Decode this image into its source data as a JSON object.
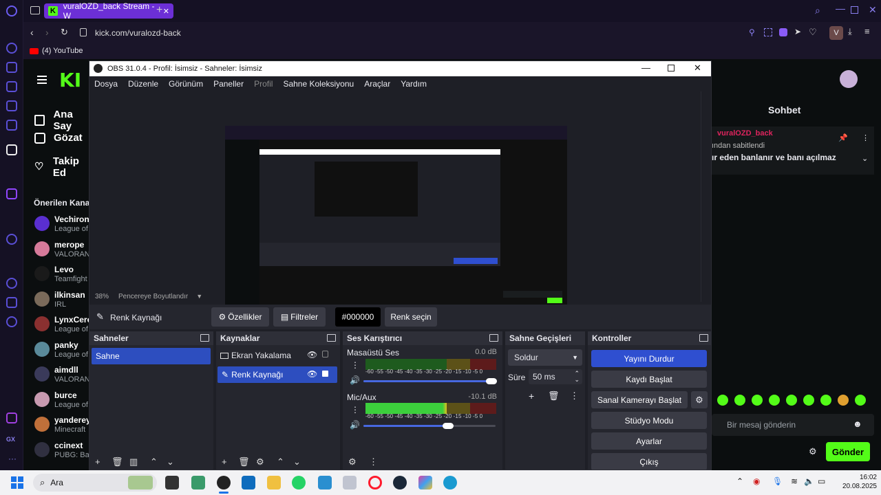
{
  "browser": {
    "tab_title": "vuralOZD_back Stream - W",
    "url": "kick.com/vuralozd-back",
    "bookmark": "(4) YouTube",
    "profile_initial": "V"
  },
  "kick": {
    "nav": [
      "Ana Say",
      "Gözat",
      "Takip Ed"
    ],
    "recommended_title": "Önerilen Kana",
    "channels": [
      {
        "name": "Vechiron",
        "game": "League of",
        "color": "#5a2fd0"
      },
      {
        "name": "merope",
        "game": "VALORAN",
        "color": "#d67a9a"
      },
      {
        "name": "Levo",
        "game": "Teamfight",
        "color": "#1a1a1a"
      },
      {
        "name": "ilkinsan",
        "game": "IRL",
        "color": "#7a6a5a"
      },
      {
        "name": "LynxCere",
        "game": "League of",
        "color": "#8a3030"
      },
      {
        "name": "panky",
        "game": "League of",
        "color": "#5a8a9a"
      },
      {
        "name": "aimdll",
        "game": "VALORAN",
        "color": "#3a3a5a"
      },
      {
        "name": "burce",
        "game": "League of",
        "color": "#c89ab0"
      },
      {
        "name": "yanderey",
        "game": "Minecraft",
        "color": "#c0703a"
      },
      {
        "name": "ccinext",
        "game": "PUBG: Bat",
        "color": "#303040"
      }
    ],
    "chat": {
      "title": "Sohbet",
      "pinned_user": "vuralOZD_back",
      "pinned_label": "ından sabitlendi",
      "pinned_message": "ır eden banlanır ve banı açılmaz",
      "input_placeholder": "Bir mesaj gönderin",
      "send_label": "Gönder"
    }
  },
  "obs": {
    "title": "OBS 31.0.4 - Profil: İsimsiz - Sahneler: İsimsiz",
    "menu": [
      "Dosya",
      "Düzenle",
      "Görünüm",
      "Paneller",
      "Profil",
      "Sahne Koleksiyonu",
      "Araçlar",
      "Yardım"
    ],
    "zoom": "38%",
    "zoom_mode": "Pencereye Boyutlandır",
    "context": {
      "source_name": "Renk Kaynağı",
      "properties": "Özellikler",
      "filters": "Filtreler",
      "color_value": "#000000",
      "pick_color": "Renk seçin"
    },
    "scenes": {
      "title": "Sahneler",
      "items": [
        "Sahne"
      ]
    },
    "sources": {
      "title": "Kaynaklar",
      "items": [
        "Ekran Yakalama",
        "Renk Kaynağı"
      ]
    },
    "mixer": {
      "title": "Ses Karıştırıcı",
      "scale": "-60 -55 -50 -45 -40 -35 -30 -25 -20 -15 -10  -5   0",
      "channels": [
        {
          "name": "Masaüstü Ses",
          "db": "0.0 dB",
          "level": 0.0,
          "volume": 0.97
        },
        {
          "name": "Mic/Aux",
          "db": "-10.1 dB",
          "level": 0.62,
          "volume": 0.64
        }
      ]
    },
    "transitions": {
      "title": "Sahne Geçişleri",
      "type": "Soldur",
      "duration_label": "Süre",
      "duration": "50 ms"
    },
    "controls": {
      "title": "Kontroller",
      "buttons": [
        "Yayını Durdur",
        "Kaydı Başlat",
        "Sanal Kamerayı Başlat",
        "Stüdyo Modu",
        "Ayarlar",
        "Çıkış"
      ]
    }
  },
  "taskbar": {
    "search": "Ara",
    "time": "16:02",
    "date": "20.08.2025"
  }
}
